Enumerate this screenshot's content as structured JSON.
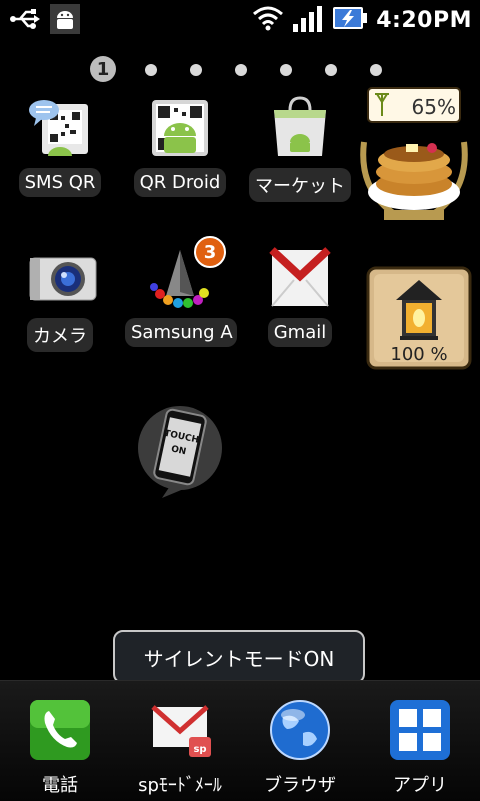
{
  "status_bar": {
    "time": "4:20PM",
    "icons": [
      "usb-icon",
      "android-debug-icon",
      "wifi-icon",
      "signal-icon",
      "battery-charging-icon"
    ]
  },
  "home": {
    "page_indicator": {
      "current": "1",
      "total": 7
    },
    "apps": [
      {
        "label": "SMS QR",
        "icon": "qr-message-icon"
      },
      {
        "label": "QR Droid",
        "icon": "qr-droid-icon"
      },
      {
        "label": "マーケット",
        "icon": "market-bag-icon"
      },
      {
        "label": "カメラ",
        "icon": "camera-icon"
      },
      {
        "label": "Samsung A",
        "icon": "samsung-apps-icon",
        "badge": "3"
      },
      {
        "label": "Gmail",
        "icon": "gmail-icon"
      }
    ],
    "widgets": {
      "signal_widget": {
        "value": "65%"
      },
      "lantern_widget": {
        "value": "100 %"
      },
      "touch_on_widget": {
        "text": "TOUCH ON"
      }
    },
    "toast": "サイレントモードON"
  },
  "dock": [
    {
      "label": "電話",
      "icon": "phone-icon"
    },
    {
      "label": "spﾓｰﾄﾞﾒｰﾙ",
      "icon": "sp-mail-icon"
    },
    {
      "label": "ブラウザ",
      "icon": "browser-globe-icon"
    },
    {
      "label": "アプリ",
      "icon": "app-grid-icon"
    }
  ]
}
